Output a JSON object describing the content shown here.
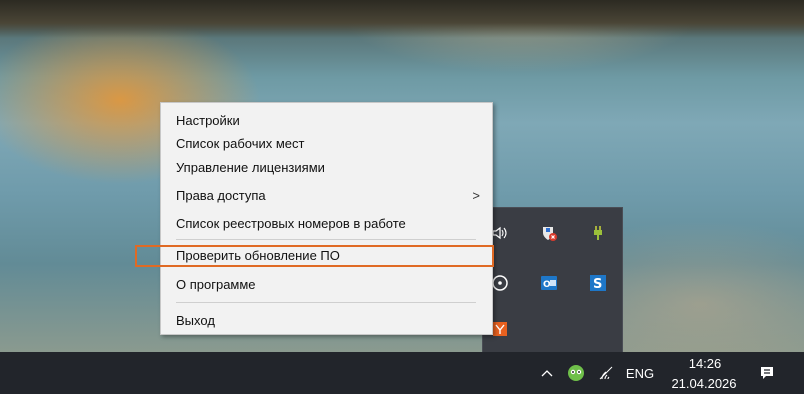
{
  "context_menu": {
    "items": [
      {
        "label": "Настройки"
      },
      {
        "label": "Список рабочих мест"
      },
      {
        "label": "Управление лицензиями"
      },
      {
        "label": "Права доступа",
        "submenu_arrow": ">"
      },
      {
        "label": "Список реестровых номеров в работе"
      },
      {
        "label": "Проверить обновление ПО",
        "highlighted": true
      },
      {
        "label": "О программе"
      },
      {
        "label": "Выход"
      }
    ]
  },
  "tray_panel": {
    "icons": [
      "volume-icon",
      "shield-alert-icon",
      "power-plug-icon",
      "clock-circle-icon",
      "outlook-icon",
      "skype-s-icon",
      "app-orange-icon"
    ]
  },
  "taskbar": {
    "language": "ENG",
    "time": "14:26",
    "date": "21.04.2026",
    "icons": [
      "chevron-up-icon",
      "app-tray-icon",
      "wifi-icon",
      "notification-icon"
    ]
  },
  "colors": {
    "highlight_border": "#e06a24",
    "taskbar_bg": "#22252b",
    "menu_bg": "#f2f2f2"
  }
}
